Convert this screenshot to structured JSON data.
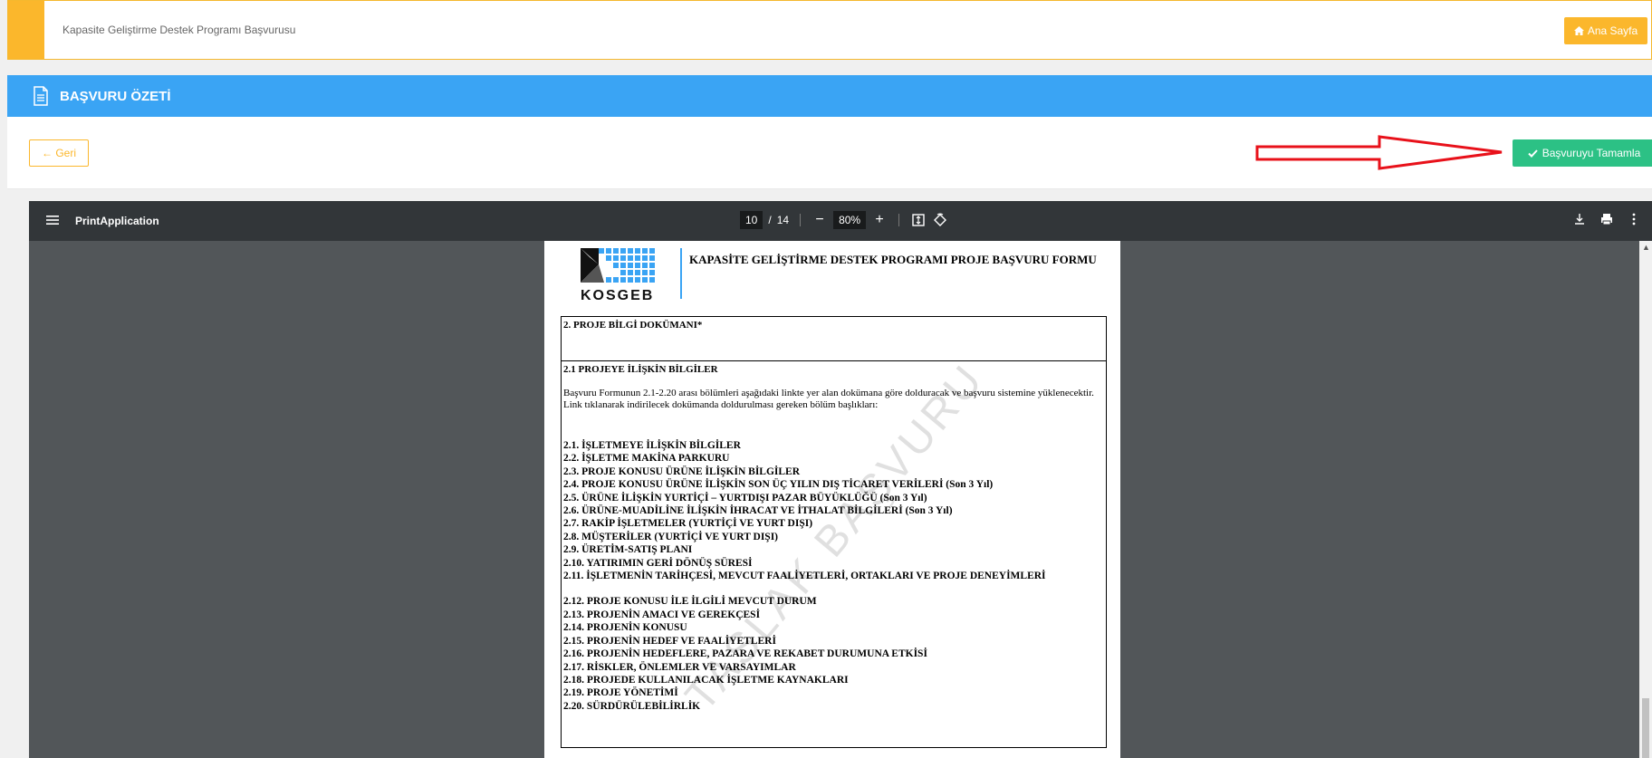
{
  "topbar": {
    "title": "Kapasite Geliştirme Destek Programı Başvurusu",
    "home_label": "Ana Sayfa"
  },
  "header": {
    "title": "BAŞVURU ÖZETİ"
  },
  "actions": {
    "back_label": "Geri",
    "complete_label": "Başvuruyu Tamamla"
  },
  "viewer": {
    "doc_name": "PrintApplication",
    "current_page": "10",
    "page_separator": "/",
    "total_pages": "14",
    "zoom": "80%"
  },
  "document": {
    "form_title": "KAPASİTE GELİŞTİRME DESTEK PROGRAMI PROJE BAŞVURU FORMU",
    "logo_text": "KOSGEB",
    "section_title": "2. PROJE BİLGİ DOKÜMANI*",
    "subsection_title": "2.1 PROJEYE İLİŞKİN BİLGİLER",
    "intro_1": "Başvuru Formunun 2.1-2.20 arası bölümleri aşağıdaki linkte yer alan dokümana göre dolduracak ve başvuru sistemine yüklenecektir.",
    "intro_2": "Link tıklanarak indirilecek dokümanda doldurulması gereken bölüm başlıkları:",
    "items_a": [
      "2.1. İŞLETMEYE İLİŞKİN BİLGİLER",
      "2.2. İŞLETME MAKİNA PARKURU",
      "2.3. PROJE KONUSU ÜRÜNE İLİŞKİN BİLGİLER",
      "2.4. PROJE KONUSU ÜRÜNE İLİŞKİN SON ÜÇ YILIN DIŞ TİCARET VERİLERİ (Son 3 Yıl)",
      "2.5. ÜRÜNE İLİŞKİN YURTİÇİ – YURTDIŞI PAZAR BÜYÜKLÜĞÜ (Son 3 Yıl)",
      "2.6. ÜRÜNE-MUADİLİNE İLİŞKİN İHRACAT VE İTHALAT BİLGİLERİ (Son 3 Yıl)",
      "2.7. RAKİP İŞLETMELER (YURTİÇİ VE YURT DIŞI)",
      "2.8. MÜŞTERİLER (YURTİÇİ VE YURT DIŞI)",
      "2.9. ÜRETİM-SATIŞ PLANI",
      "2.10. YATIRIMIN GERİ DÖNÜŞ SÜRESİ",
      "2.11. İŞLETMENİN TARİHÇESİ, MEVCUT FAALİYETLERİ, ORTAKLARI VE PROJE DENEYİMLERİ"
    ],
    "items_b": [
      "2.12. PROJE KONUSU İLE İLGİLİ MEVCUT DURUM",
      "2.13. PROJENİN AMACI VE GEREKÇESİ",
      "2.14. PROJENİN KONUSU",
      "2.15. PROJENİN HEDEF VE FAALİYETLERİ",
      "2.16. PROJENİN HEDEFLERE, PAZARA VE REKABET DURUMUNA ETKİSİ",
      "2.17. RİSKLER, ÖNLEMLER VE VARSAYIMLAR",
      "2.18. PROJEDE KULLANILACAK İŞLETME KAYNAKLARI",
      "2.19. PROJE YÖNETİMİ",
      "2.20. SÜRDÜRÜLEBİLİRLİK"
    ],
    "watermark": "TASLAK BAŞVURU"
  },
  "colors": {
    "accent": "#fbb72c",
    "header_blue": "#3aa4f4",
    "success": "#2cc185",
    "arrow": "#e8111a"
  }
}
